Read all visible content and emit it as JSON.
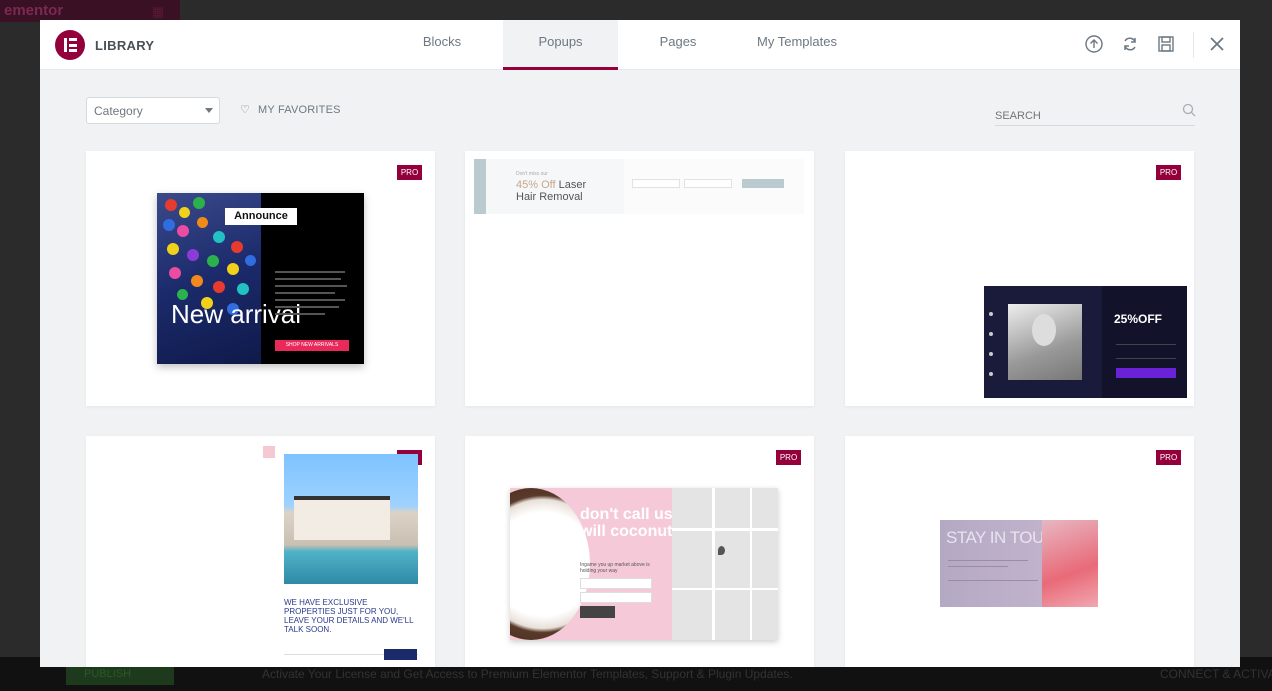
{
  "background": {
    "brand_fragment": "ementor",
    "publish_label": "PUBLISH",
    "notice": "Activate Your License and Get Access to Premium Elementor Templates, Support & Plugin Updates.",
    "connect": "CONNECT & ACTIVATE"
  },
  "header": {
    "title": "LIBRARY",
    "tabs": [
      {
        "label": "Blocks",
        "active": false
      },
      {
        "label": "Popups",
        "active": true
      },
      {
        "label": "Pages",
        "active": false
      },
      {
        "label": "My Templates",
        "active": false
      }
    ],
    "icons": [
      "upload-icon",
      "sync-icon",
      "save-icon",
      "close-icon"
    ]
  },
  "toolbar": {
    "category_value": "Category",
    "favorites_label": "MY FAVORITES",
    "search_placeholder": "SEARCH"
  },
  "badge_label": "PRO",
  "cards": [
    {
      "announce": "Announce",
      "headline": "New arrival",
      "button": "SHOP NEW ARRIVALS"
    },
    {
      "small": "Don't miss our",
      "title_accent": "45% Off",
      "title_rest": "Laser",
      "title_line2": "Hair Removal"
    },
    {
      "offer": "25%OFF"
    },
    {
      "text": "WE HAVE EXCLUSIVE PROPERTIES JUST FOR YOU, LEAVE YOUR DETAILS AND WE'LL TALK SOON."
    },
    {
      "headline": "don't call us we will coconut you",
      "sub": "Ingame you up market above is holding your way"
    },
    {
      "title": "STAY IN TOUCH"
    }
  ],
  "colors": {
    "brand": "#93003c",
    "tab_text": "#6d7882",
    "modal_bg": "#f1f2f3"
  }
}
